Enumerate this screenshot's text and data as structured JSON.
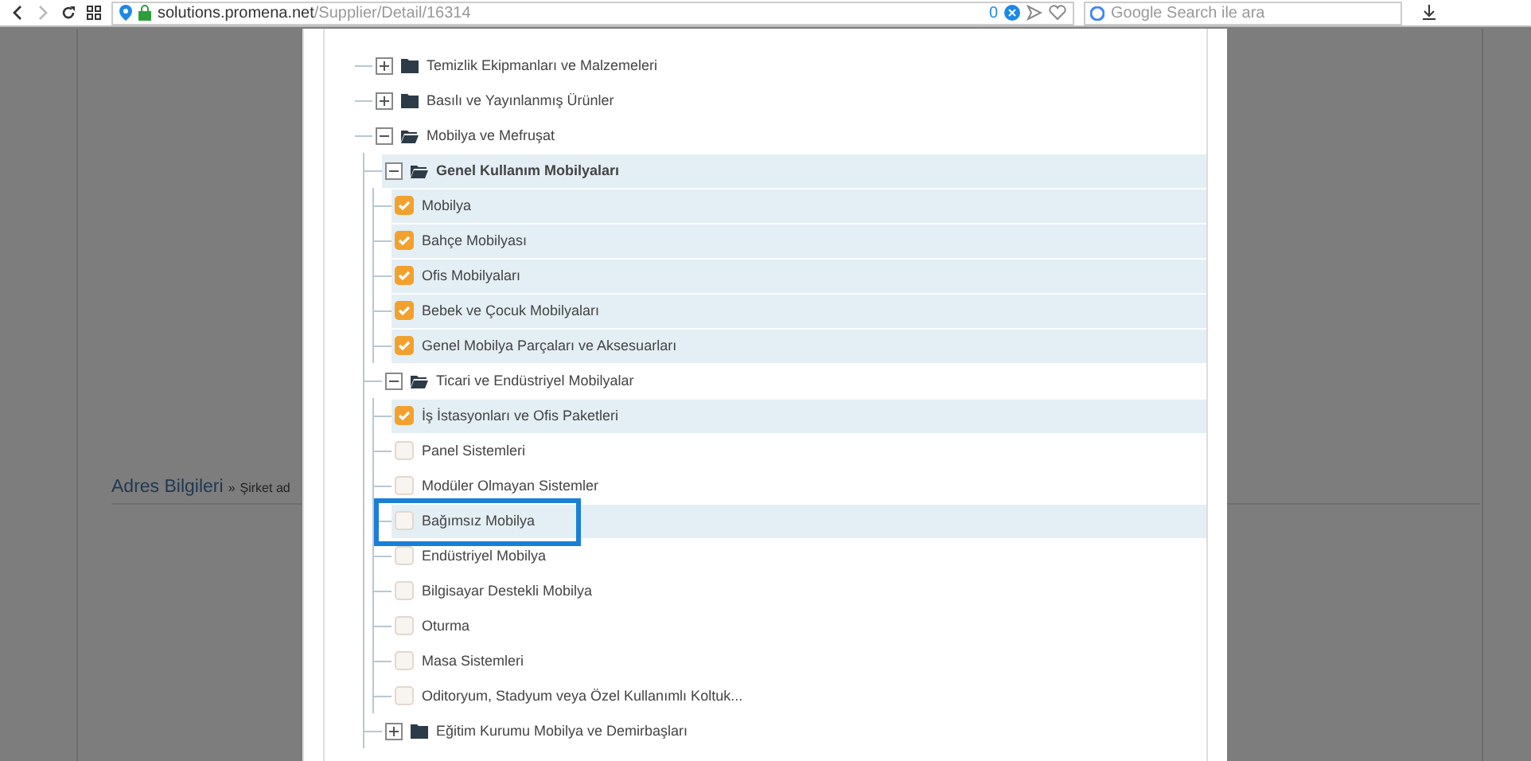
{
  "browser": {
    "url_host": "solutions.promena.net",
    "url_path": "/Supplier/Detail/16314",
    "badge_count": "0",
    "search": {
      "placeholder": "Google Search ile ara"
    }
  },
  "background_page": {
    "section_title": "Adres Bilgileri",
    "breadcrumb_separator": "»",
    "section_subtitle": "Şirket ad"
  },
  "tree": [
    {
      "kind": "folder",
      "label": "Temizlik Ekipmanları ve Malzemeleri",
      "expanded": false,
      "highlighted": false,
      "emphasized": false
    },
    {
      "kind": "folder",
      "label": "Basılı ve Yayınlanmış Ürünler",
      "expanded": false,
      "highlighted": false,
      "emphasized": false
    },
    {
      "kind": "folder",
      "label": "Mobilya ve Mefruşat",
      "expanded": true,
      "highlighted": false,
      "emphasized": false,
      "children": [
        {
          "kind": "folder",
          "label": "Genel Kullanım Mobilyaları",
          "expanded": true,
          "highlighted": true,
          "emphasized": true,
          "children": [
            {
              "kind": "option",
              "label": "Mobilya",
              "checked": true,
              "highlighted": true,
              "annotated": false
            },
            {
              "kind": "option",
              "label": "Bahçe Mobilyası",
              "checked": true,
              "highlighted": true,
              "annotated": false
            },
            {
              "kind": "option",
              "label": "Ofis Mobilyaları",
              "checked": true,
              "highlighted": true,
              "annotated": false
            },
            {
              "kind": "option",
              "label": "Bebek ve Çocuk Mobilyaları",
              "checked": true,
              "highlighted": true,
              "annotated": false
            },
            {
              "kind": "option",
              "label": "Genel Mobilya Parçaları ve Aksesuarları",
              "checked": true,
              "highlighted": true,
              "annotated": false
            }
          ]
        },
        {
          "kind": "folder",
          "label": "Ticari ve Endüstriyel Mobilyalar",
          "expanded": true,
          "highlighted": false,
          "emphasized": false,
          "children": [
            {
              "kind": "option",
              "label": "İş İstasyonları ve Ofis Paketleri",
              "checked": true,
              "highlighted": true,
              "annotated": false
            },
            {
              "kind": "option",
              "label": "Panel Sistemleri",
              "checked": false,
              "highlighted": false,
              "annotated": false
            },
            {
              "kind": "option",
              "label": "Modüler Olmayan Sistemler",
              "checked": false,
              "highlighted": false,
              "annotated": false
            },
            {
              "kind": "option",
              "label": "Bağımsız Mobilya",
              "checked": false,
              "highlighted": true,
              "annotated": true
            },
            {
              "kind": "option",
              "label": "Endüstriyel Mobilya",
              "checked": false,
              "highlighted": false,
              "annotated": false
            },
            {
              "kind": "option",
              "label": "Bilgisayar Destekli Mobilya",
              "checked": false,
              "highlighted": false,
              "annotated": false
            },
            {
              "kind": "option",
              "label": "Oturma",
              "checked": false,
              "highlighted": false,
              "annotated": false
            },
            {
              "kind": "option",
              "label": "Masa Sistemleri",
              "checked": false,
              "highlighted": false,
              "annotated": false
            },
            {
              "kind": "option",
              "label": "Oditoryum, Stadyum veya Özel Kullanımlı Koltuk...",
              "checked": false,
              "highlighted": false,
              "annotated": false
            }
          ]
        },
        {
          "kind": "folder",
          "label": "Eğitim Kurumu Mobilya ve Demirbaşları",
          "expanded": false,
          "highlighted": false,
          "emphasized": false
        }
      ]
    }
  ]
}
